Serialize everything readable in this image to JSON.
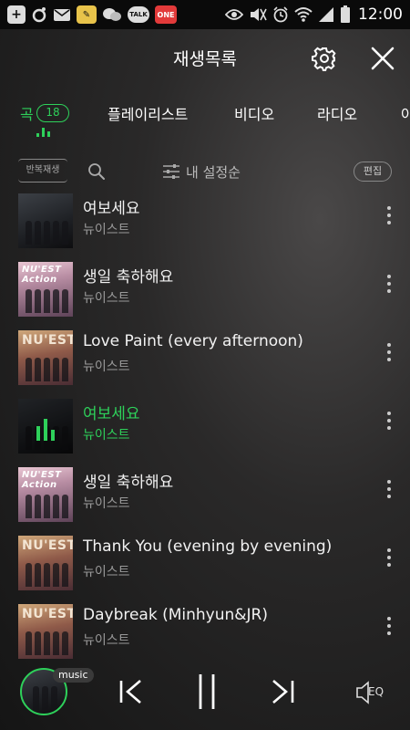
{
  "status_bar": {
    "time": "12:00",
    "talk_label": "TALK",
    "one_label": "ONE",
    "icons": [
      "plus-icon",
      "circle-icon",
      "mail-icon",
      "chat-icon",
      "talk-icon",
      "one-store-icon",
      "eye-icon",
      "mute-icon",
      "alarm-icon",
      "wifi-icon",
      "signal-icon",
      "battery-icon"
    ]
  },
  "header": {
    "title": "재생목록"
  },
  "tabs": [
    {
      "label": "곡",
      "badge": "18",
      "active": true
    },
    {
      "label": "플레이리스트"
    },
    {
      "label": "비디오"
    },
    {
      "label": "라디오"
    },
    {
      "label": "아"
    }
  ],
  "toolbar": {
    "repeat_label": "반복재생",
    "sort_label": "내 설정순",
    "edit_label": "편집"
  },
  "tracks": [
    {
      "title": "여보세요",
      "artist": "뉴이스트",
      "art": "dark"
    },
    {
      "title": "생일 축하해요",
      "artist": "뉴이스트",
      "art": "pink",
      "art_text": "NU'EST Action"
    },
    {
      "title": "Love Paint (every afternoon)",
      "artist": "뉴이스트",
      "art": "bronze",
      "art_text": "NU'EST"
    },
    {
      "title": "여보세요",
      "artist": "뉴이스트",
      "art": "dark",
      "playing": true
    },
    {
      "title": "생일 축하해요",
      "artist": "뉴이스트",
      "art": "pink",
      "art_text": "NU'EST Action"
    },
    {
      "title": "Thank You (evening by evening)",
      "artist": "뉴이스트",
      "art": "bronze",
      "art_text": "NU'EST"
    },
    {
      "title": "Daybreak (Minhyun&JR)",
      "artist": "뉴이스트",
      "art": "bronze",
      "art_text": "NU'EST"
    }
  ],
  "player": {
    "badge": "music",
    "eq_label": "EQ"
  },
  "colors": {
    "accent": "#2ed05a",
    "background": "#1f1e1e"
  }
}
